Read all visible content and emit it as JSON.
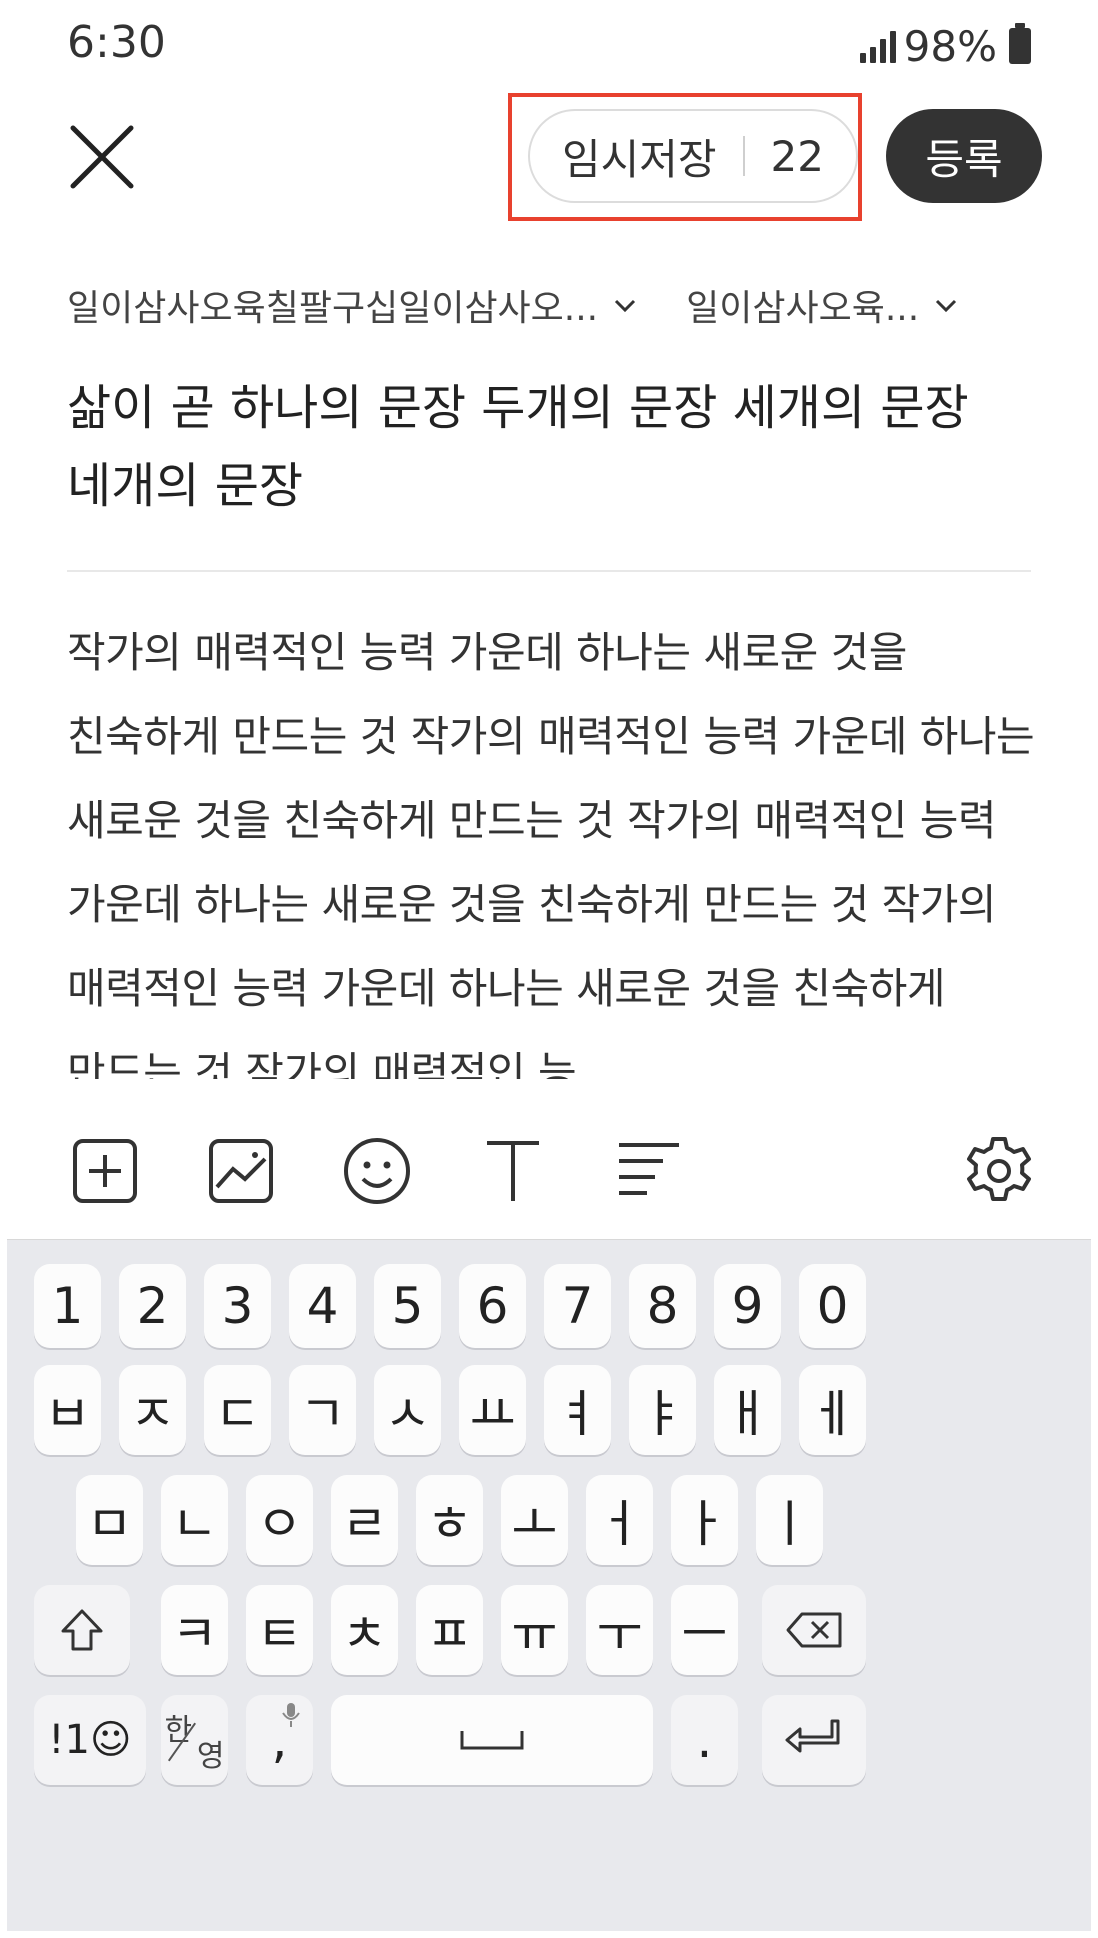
{
  "status_bar": {
    "time": "6:30",
    "battery": "98%"
  },
  "header": {
    "close_icon": "close-icon",
    "draft_label": "임시저장",
    "draft_count": "22",
    "submit_label": "등록"
  },
  "categories": [
    {
      "label": "일이삼사오육칠팔구십일이삼사오..."
    },
    {
      "label": "일이삼사오육..."
    }
  ],
  "title": "삶이 곧 하나의 문장 두개의 문장 세개의 문장 네개의 문장",
  "body": "작가의 매력적인 능력 가운데 하나는 새로운 것을 친숙하게 만드는 것 작가의 매력적인 능력 가운데 하나는 새로운 것을 친숙하게 만드는 것 작가의 매력적인 능력 가운데 하나는 새로운 것을 친숙하게 만드는 것 작가의 매력적인 능력 가운데 하나는 새로운 것을 친숙하게 만드는 것 작가의 매력적인 능",
  "toolbar": {
    "icons": [
      "add-icon",
      "image-icon",
      "emoji-icon",
      "text-style-icon",
      "align-icon",
      "settings-icon"
    ]
  },
  "keyboard": {
    "row1": [
      "1",
      "2",
      "3",
      "4",
      "5",
      "6",
      "7",
      "8",
      "9",
      "0"
    ],
    "row2": [
      "ㅂ",
      "ㅈ",
      "ㄷ",
      "ㄱ",
      "ㅅ",
      "ㅛ",
      "ㅕ",
      "ㅑ",
      "ㅐ",
      "ㅔ"
    ],
    "row3": [
      "ㅁ",
      "ㄴ",
      "ㅇ",
      "ㄹ",
      "ㅎ",
      "ㅗ",
      "ㅓ",
      "ㅏ",
      "ㅣ"
    ],
    "row4": [
      "ㅋ",
      "ㅌ",
      "ㅊ",
      "ㅍ",
      "ㅠ",
      "ㅜ",
      "ㅡ"
    ],
    "symbols_label": "!1☺",
    "hangul_label": "한",
    "english_label": "영",
    "comma_label": ",",
    "period_label": "."
  },
  "colors": {
    "highlight": "#e8412e",
    "submit_bg": "#333333",
    "keyboard_bg": "#e8e9ed"
  }
}
